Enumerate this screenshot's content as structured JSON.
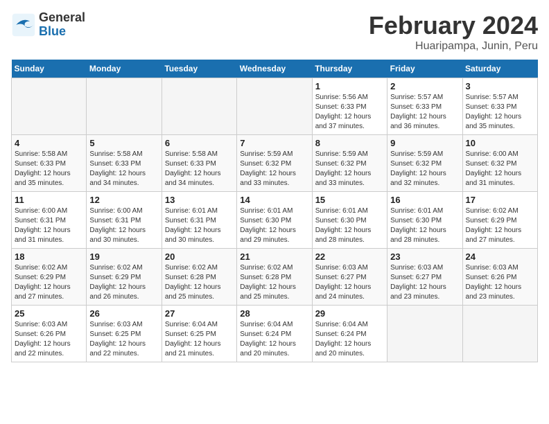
{
  "header": {
    "logo_line1": "General",
    "logo_line2": "Blue",
    "title": "February 2024",
    "subtitle": "Huaripampa, Junin, Peru"
  },
  "columns": [
    "Sunday",
    "Monday",
    "Tuesday",
    "Wednesday",
    "Thursday",
    "Friday",
    "Saturday"
  ],
  "weeks": [
    [
      {
        "day": "",
        "info": ""
      },
      {
        "day": "",
        "info": ""
      },
      {
        "day": "",
        "info": ""
      },
      {
        "day": "",
        "info": ""
      },
      {
        "day": "1",
        "info": "Sunrise: 5:56 AM\nSunset: 6:33 PM\nDaylight: 12 hours and 37 minutes."
      },
      {
        "day": "2",
        "info": "Sunrise: 5:57 AM\nSunset: 6:33 PM\nDaylight: 12 hours and 36 minutes."
      },
      {
        "day": "3",
        "info": "Sunrise: 5:57 AM\nSunset: 6:33 PM\nDaylight: 12 hours and 35 minutes."
      }
    ],
    [
      {
        "day": "4",
        "info": "Sunrise: 5:58 AM\nSunset: 6:33 PM\nDaylight: 12 hours and 35 minutes."
      },
      {
        "day": "5",
        "info": "Sunrise: 5:58 AM\nSunset: 6:33 PM\nDaylight: 12 hours and 34 minutes."
      },
      {
        "day": "6",
        "info": "Sunrise: 5:58 AM\nSunset: 6:33 PM\nDaylight: 12 hours and 34 minutes."
      },
      {
        "day": "7",
        "info": "Sunrise: 5:59 AM\nSunset: 6:32 PM\nDaylight: 12 hours and 33 minutes."
      },
      {
        "day": "8",
        "info": "Sunrise: 5:59 AM\nSunset: 6:32 PM\nDaylight: 12 hours and 33 minutes."
      },
      {
        "day": "9",
        "info": "Sunrise: 5:59 AM\nSunset: 6:32 PM\nDaylight: 12 hours and 32 minutes."
      },
      {
        "day": "10",
        "info": "Sunrise: 6:00 AM\nSunset: 6:32 PM\nDaylight: 12 hours and 31 minutes."
      }
    ],
    [
      {
        "day": "11",
        "info": "Sunrise: 6:00 AM\nSunset: 6:31 PM\nDaylight: 12 hours and 31 minutes."
      },
      {
        "day": "12",
        "info": "Sunrise: 6:00 AM\nSunset: 6:31 PM\nDaylight: 12 hours and 30 minutes."
      },
      {
        "day": "13",
        "info": "Sunrise: 6:01 AM\nSunset: 6:31 PM\nDaylight: 12 hours and 30 minutes."
      },
      {
        "day": "14",
        "info": "Sunrise: 6:01 AM\nSunset: 6:30 PM\nDaylight: 12 hours and 29 minutes."
      },
      {
        "day": "15",
        "info": "Sunrise: 6:01 AM\nSunset: 6:30 PM\nDaylight: 12 hours and 28 minutes."
      },
      {
        "day": "16",
        "info": "Sunrise: 6:01 AM\nSunset: 6:30 PM\nDaylight: 12 hours and 28 minutes."
      },
      {
        "day": "17",
        "info": "Sunrise: 6:02 AM\nSunset: 6:29 PM\nDaylight: 12 hours and 27 minutes."
      }
    ],
    [
      {
        "day": "18",
        "info": "Sunrise: 6:02 AM\nSunset: 6:29 PM\nDaylight: 12 hours and 27 minutes."
      },
      {
        "day": "19",
        "info": "Sunrise: 6:02 AM\nSunset: 6:29 PM\nDaylight: 12 hours and 26 minutes."
      },
      {
        "day": "20",
        "info": "Sunrise: 6:02 AM\nSunset: 6:28 PM\nDaylight: 12 hours and 25 minutes."
      },
      {
        "day": "21",
        "info": "Sunrise: 6:02 AM\nSunset: 6:28 PM\nDaylight: 12 hours and 25 minutes."
      },
      {
        "day": "22",
        "info": "Sunrise: 6:03 AM\nSunset: 6:27 PM\nDaylight: 12 hours and 24 minutes."
      },
      {
        "day": "23",
        "info": "Sunrise: 6:03 AM\nSunset: 6:27 PM\nDaylight: 12 hours and 23 minutes."
      },
      {
        "day": "24",
        "info": "Sunrise: 6:03 AM\nSunset: 6:26 PM\nDaylight: 12 hours and 23 minutes."
      }
    ],
    [
      {
        "day": "25",
        "info": "Sunrise: 6:03 AM\nSunset: 6:26 PM\nDaylight: 12 hours and 22 minutes."
      },
      {
        "day": "26",
        "info": "Sunrise: 6:03 AM\nSunset: 6:25 PM\nDaylight: 12 hours and 22 minutes."
      },
      {
        "day": "27",
        "info": "Sunrise: 6:04 AM\nSunset: 6:25 PM\nDaylight: 12 hours and 21 minutes."
      },
      {
        "day": "28",
        "info": "Sunrise: 6:04 AM\nSunset: 6:24 PM\nDaylight: 12 hours and 20 minutes."
      },
      {
        "day": "29",
        "info": "Sunrise: 6:04 AM\nSunset: 6:24 PM\nDaylight: 12 hours and 20 minutes."
      },
      {
        "day": "",
        "info": ""
      },
      {
        "day": "",
        "info": ""
      }
    ]
  ]
}
